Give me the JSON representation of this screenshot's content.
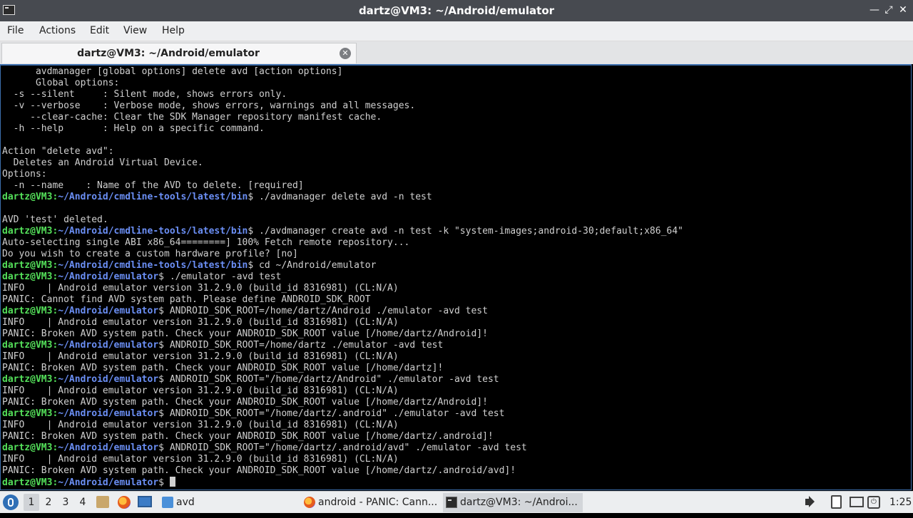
{
  "window": {
    "title": "dartz@VM3: ~/Android/emulator",
    "controls": [
      "minimize",
      "maximize",
      "close"
    ]
  },
  "menubar": {
    "items": [
      "File",
      "Actions",
      "Edit",
      "View",
      "Help"
    ]
  },
  "tabs": [
    {
      "label": "dartz@VM3: ~/Android/emulator",
      "active": true
    }
  ],
  "terminal": {
    "colors": {
      "background": "#000000",
      "text": "#d0d0d0",
      "prompt_user": "#54e05a",
      "prompt_path": "#6b8ff5"
    },
    "lines": [
      {
        "text": "      avdmanager [global options] delete avd [action options]"
      },
      {
        "text": "      Global options:"
      },
      {
        "text": "  -s --silent     : Silent mode, shows errors only."
      },
      {
        "text": "  -v --verbose    : Verbose mode, shows errors, warnings and all messages."
      },
      {
        "text": "     --clear-cache: Clear the SDK Manager repository manifest cache."
      },
      {
        "text": "  -h --help       : Help on a specific command."
      },
      {
        "text": ""
      },
      {
        "text": "Action \"delete avd\":"
      },
      {
        "text": "  Deletes an Android Virtual Device."
      },
      {
        "text": "Options:"
      },
      {
        "text": "  -n --name    : Name of the AVD to delete. [required]"
      },
      {
        "user": "dartz@VM3",
        "path": "~/Android/cmdline-tools/latest/bin",
        "cmd": "$ ./avdmanager delete avd -n test"
      },
      {
        "text": ""
      },
      {
        "text": "AVD 'test' deleted."
      },
      {
        "user": "dartz@VM3",
        "path": "~/Android/cmdline-tools/latest/bin",
        "cmd": "$ ./avdmanager create avd -n test -k \"system-images;android-30;default;x86_64\""
      },
      {
        "text": "Auto-selecting single ABI x86_64========] 100% Fetch remote repository..."
      },
      {
        "text": "Do you wish to create a custom hardware profile? [no]"
      },
      {
        "user": "dartz@VM3",
        "path": "~/Android/cmdline-tools/latest/bin",
        "cmd": "$ cd ~/Android/emulator"
      },
      {
        "user": "dartz@VM3",
        "path": "~/Android/emulator",
        "cmd": "$ ./emulator -avd test"
      },
      {
        "text": "INFO    | Android emulator version 31.2.9.0 (build_id 8316981) (CL:N/A)"
      },
      {
        "text": "PANIC: Cannot find AVD system path. Please define ANDROID_SDK_ROOT"
      },
      {
        "user": "dartz@VM3",
        "path": "~/Android/emulator",
        "cmd": "$ ANDROID_SDK_ROOT=/home/dartz/Android ./emulator -avd test"
      },
      {
        "text": "INFO    | Android emulator version 31.2.9.0 (build_id 8316981) (CL:N/A)"
      },
      {
        "text": "PANIC: Broken AVD system path. Check your ANDROID_SDK_ROOT value [/home/dartz/Android]!"
      },
      {
        "user": "dartz@VM3",
        "path": "~/Android/emulator",
        "cmd": "$ ANDROID_SDK_ROOT=/home/dartz ./emulator -avd test"
      },
      {
        "text": "INFO    | Android emulator version 31.2.9.0 (build_id 8316981) (CL:N/A)"
      },
      {
        "text": "PANIC: Broken AVD system path. Check your ANDROID_SDK_ROOT value [/home/dartz]!"
      },
      {
        "user": "dartz@VM3",
        "path": "~/Android/emulator",
        "cmd": "$ ANDROID_SDK_ROOT=\"/home/dartz/Android\" ./emulator -avd test"
      },
      {
        "text": "INFO    | Android emulator version 31.2.9.0 (build_id 8316981) (CL:N/A)"
      },
      {
        "text": "PANIC: Broken AVD system path. Check your ANDROID_SDK_ROOT value [/home/dartz/Android]!"
      },
      {
        "user": "dartz@VM3",
        "path": "~/Android/emulator",
        "cmd": "$ ANDROID_SDK_ROOT=\"/home/dartz/.android\" ./emulator -avd test"
      },
      {
        "text": "INFO    | Android emulator version 31.2.9.0 (build_id 8316981) (CL:N/A)"
      },
      {
        "text": "PANIC: Broken AVD system path. Check your ANDROID_SDK_ROOT value [/home/dartz/.android]!"
      },
      {
        "user": "dartz@VM3",
        "path": "~/Android/emulator",
        "cmd": "$ ANDROID_SDK_ROOT=\"/home/dartz/.android/avd\" ./emulator -avd test"
      },
      {
        "text": "INFO    | Android emulator version 31.2.9.0 (build_id 8316981) (CL:N/A)"
      },
      {
        "text": "PANIC: Broken AVD system path. Check your ANDROID_SDK_ROOT value [/home/dartz/.android/avd]!"
      },
      {
        "user": "dartz@VM3",
        "path": "~/Android/emulator",
        "cmd": "$ ",
        "cursor": true
      }
    ]
  },
  "taskbar": {
    "desktops": [
      "1",
      "2",
      "3",
      "4"
    ],
    "active_desktop": "1",
    "launchers": [
      "show-desktop-icon",
      "firefox-icon",
      "screen-icon"
    ],
    "folder_label": "avd",
    "tasks": [
      {
        "label": "android - PANIC: Cann...",
        "icon": "firefox-icon",
        "active": false
      },
      {
        "label": "dartz@VM3: ~/Androi...",
        "icon": "terminal-icon",
        "active": true
      }
    ],
    "tray": [
      "volume-icon",
      "clipboard-icon",
      "monitor-icon",
      "power-icon"
    ],
    "clock": "1:25"
  }
}
